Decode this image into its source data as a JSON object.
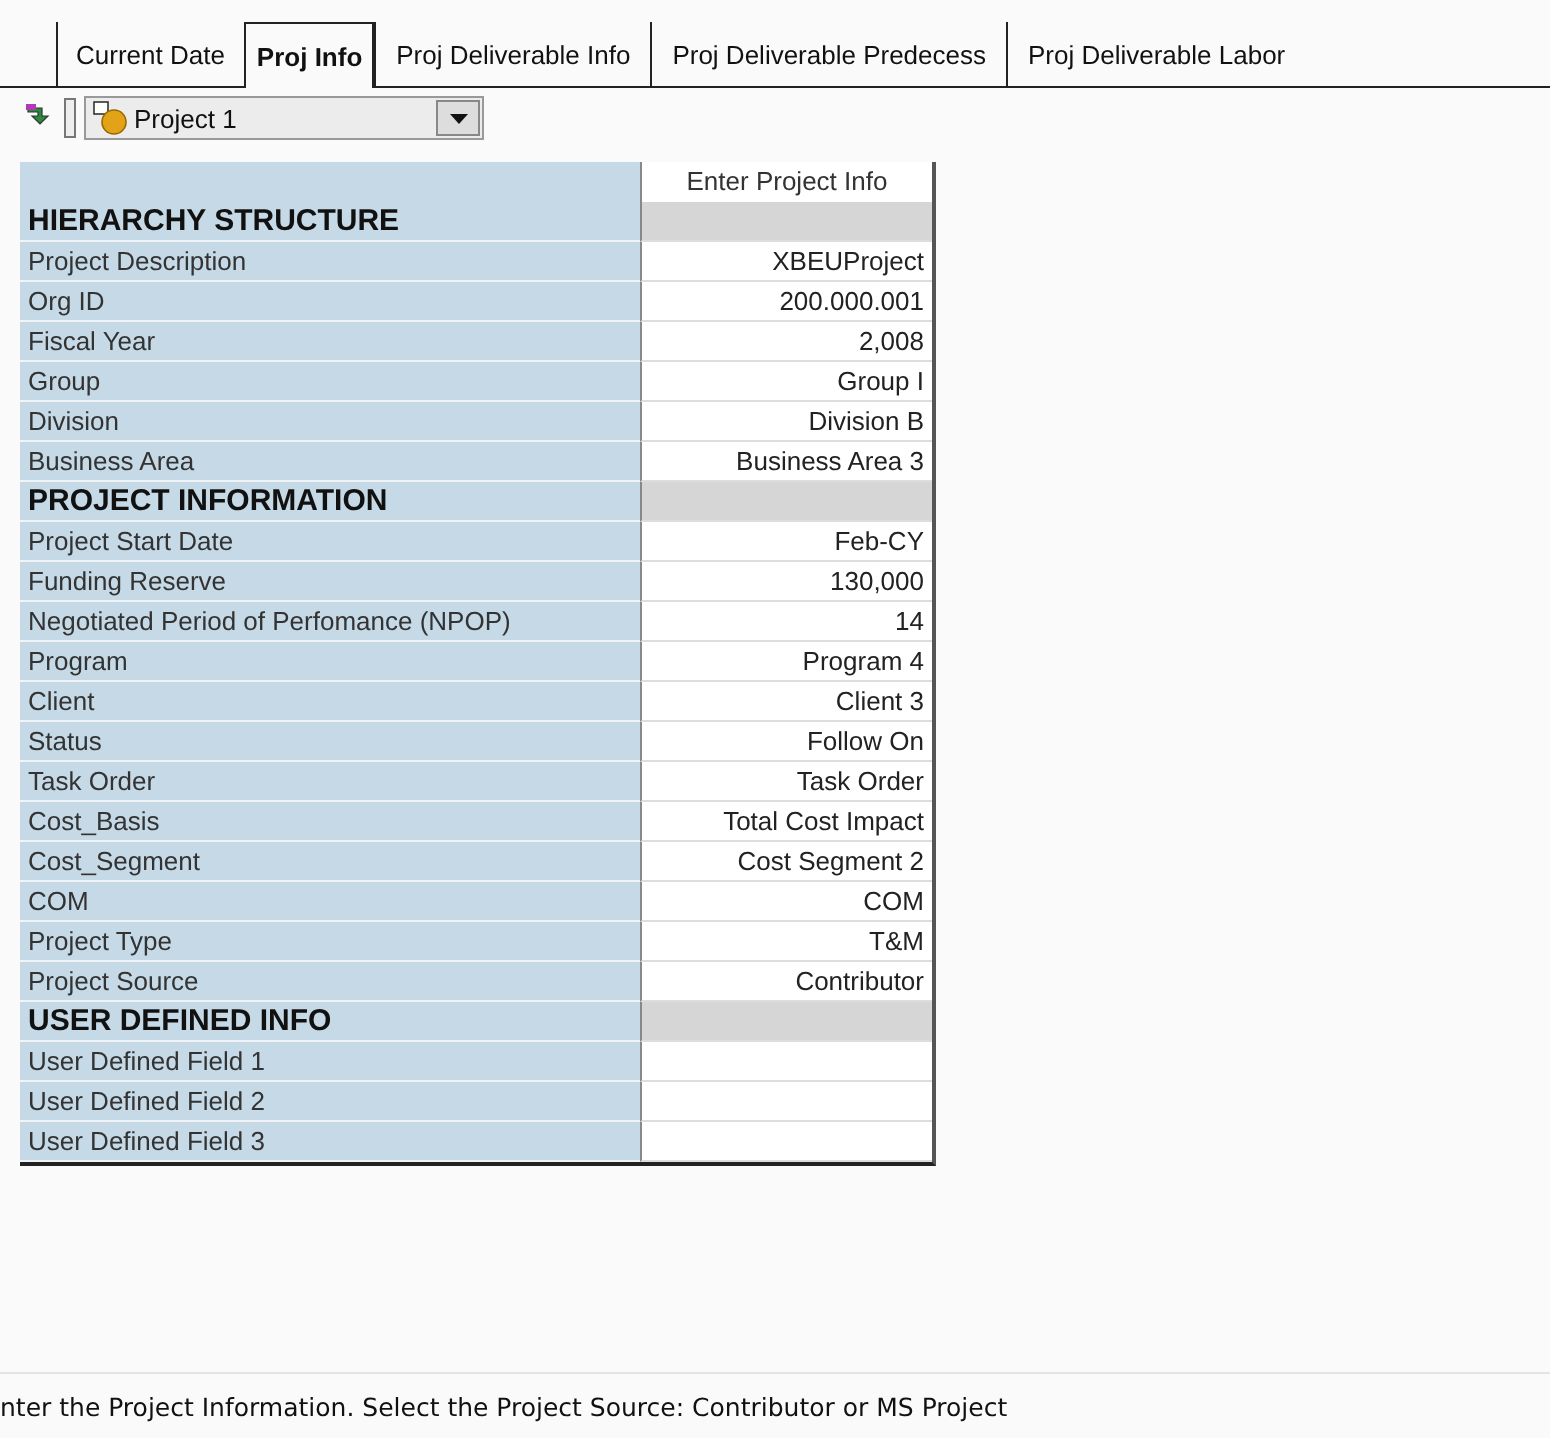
{
  "tabs": [
    {
      "label": "Current Date",
      "selected": false
    },
    {
      "label": "Proj Info",
      "selected": true
    },
    {
      "label": "Proj Deliverable Info",
      "selected": false
    },
    {
      "label": "Proj Deliverable Predecess",
      "selected": false
    },
    {
      "label": "Proj Deliverable Labor",
      "selected": false
    }
  ],
  "project_selector": {
    "value": "Project 1"
  },
  "table": {
    "header": "Enter Project Info",
    "rows": [
      {
        "kind": "section",
        "label": "HIERARCHY STRUCTURE"
      },
      {
        "kind": "field",
        "label": "Project Description",
        "value": "XBEUProject"
      },
      {
        "kind": "field",
        "label": "Org ID",
        "value": "200.000.001"
      },
      {
        "kind": "field",
        "label": "Fiscal Year",
        "value": "2,008"
      },
      {
        "kind": "field",
        "label": "Group",
        "value": "Group I"
      },
      {
        "kind": "field",
        "label": "Division",
        "value": "Division B"
      },
      {
        "kind": "field",
        "label": "Business Area",
        "value": "Business Area 3"
      },
      {
        "kind": "section",
        "label": "PROJECT INFORMATION"
      },
      {
        "kind": "field",
        "label": "Project Start Date",
        "value": "Feb-CY"
      },
      {
        "kind": "field",
        "label": "Funding Reserve",
        "value": "130,000"
      },
      {
        "kind": "field",
        "label": "Negotiated Period of Perfomance (NPOP)",
        "value": "14"
      },
      {
        "kind": "field",
        "label": "Program",
        "value": "Program 4"
      },
      {
        "kind": "field",
        "label": "Client",
        "value": "Client 3"
      },
      {
        "kind": "field",
        "label": "Status",
        "value": "Follow On"
      },
      {
        "kind": "field",
        "label": "Task Order",
        "value": "Task Order"
      },
      {
        "kind": "field",
        "label": "Cost_Basis",
        "value": "Total Cost Impact"
      },
      {
        "kind": "field",
        "label": "Cost_Segment",
        "value": "Cost Segment 2"
      },
      {
        "kind": "field",
        "label": "COM",
        "value": "COM"
      },
      {
        "kind": "field",
        "label": "Project Type",
        "value": "T&M"
      },
      {
        "kind": "field",
        "label": "Project Source",
        "value": "Contributor"
      },
      {
        "kind": "section",
        "label": "USER DEFINED INFO"
      },
      {
        "kind": "field",
        "label": "User Defined Field 1"
      },
      {
        "kind": "field",
        "label": "User Defined Field 2"
      },
      {
        "kind": "field",
        "label": "User Defined Field 3"
      }
    ]
  },
  "status_bar": "nter the Project Information.  Select the Project Source: Contributor or MS Project"
}
